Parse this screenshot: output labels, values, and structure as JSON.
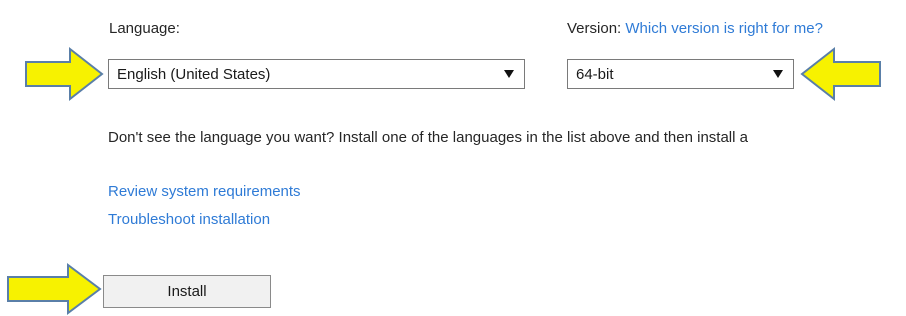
{
  "language": {
    "label": "Language:",
    "selected": "English (United States)"
  },
  "version": {
    "label": "Version:",
    "help_link": "Which version is right for me?",
    "selected": "64-bit"
  },
  "notice": "Don't see the language you want? Install one of the languages in the list above and then install a",
  "links": {
    "review": "Review system requirements",
    "troubleshoot": "Troubleshoot installation"
  },
  "install_button": "Install",
  "colors": {
    "arrow_fill": "#f7f200",
    "arrow_stroke": "#5a7fa8",
    "link": "#2f7bd6"
  }
}
